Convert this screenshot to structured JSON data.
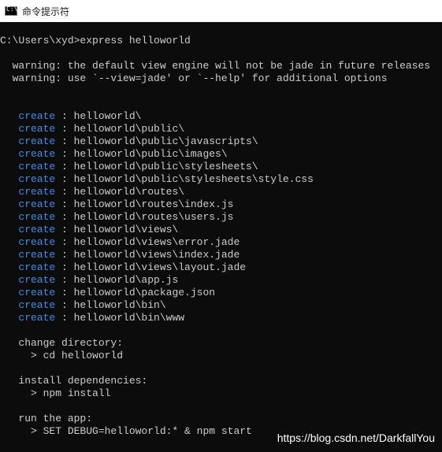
{
  "window": {
    "title": "命令提示符",
    "icon": "cmd-icon",
    "icon_glyph": "C:\\."
  },
  "colors": {
    "background": "#0c0c0c",
    "text": "#cccccc",
    "create_keyword": "#3b8eea",
    "titlebar": "#ffffff"
  },
  "console": {
    "command_line": "C:\\Users\\xyd>express helloworld",
    "warnings": [
      "  warning: the default view engine will not be jade in future releases",
      "  warning: use `--view=jade' or `--help' for additional options"
    ],
    "create_keyword": "create",
    "create_lines": [
      " : helloworld\\",
      " : helloworld\\public\\",
      " : helloworld\\public\\javascripts\\",
      " : helloworld\\public\\images\\",
      " : helloworld\\public\\stylesheets\\",
      " : helloworld\\public\\stylesheets\\style.css",
      " : helloworld\\routes\\",
      " : helloworld\\routes\\index.js",
      " : helloworld\\routes\\users.js",
      " : helloworld\\views\\",
      " : helloworld\\views\\error.jade",
      " : helloworld\\views\\index.jade",
      " : helloworld\\views\\layout.jade",
      " : helloworld\\app.js",
      " : helloworld\\package.json",
      " : helloworld\\bin\\",
      " : helloworld\\bin\\www"
    ],
    "change_directory_label": "   change directory:",
    "change_directory_cmd": "     > cd helloworld",
    "install_label": "   install dependencies:",
    "install_cmd": "     > npm install",
    "run_label": "   run the app:",
    "run_cmd": "     > SET DEBUG=helloworld:* & npm start"
  },
  "watermark": "https://blog.csdn.net/DarkfallYou"
}
